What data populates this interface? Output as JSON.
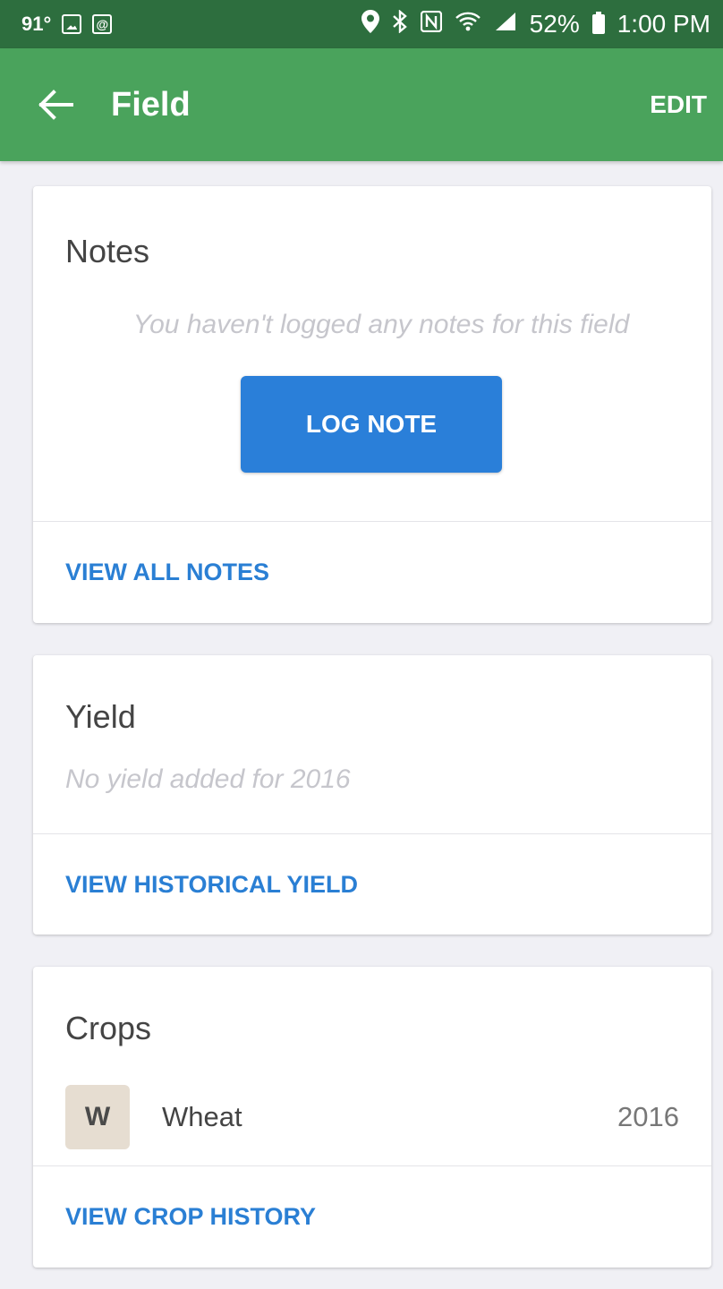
{
  "status_bar": {
    "temperature": "91°",
    "battery_percent": "52%",
    "time": "1:00 PM",
    "icons": [
      "image-icon",
      "email-at-icon",
      "location-icon",
      "bluetooth-icon",
      "nfc-icon",
      "wifi-icon",
      "signal-icon",
      "battery-icon"
    ]
  },
  "app_bar": {
    "title": "Field",
    "edit_label": "EDIT",
    "back_icon": "arrow-left-icon",
    "color": "#4aa35c"
  },
  "notes": {
    "title": "Notes",
    "empty_text": "You haven't logged any notes for this field",
    "button_label": "LOG NOTE",
    "action_label": "VIEW ALL NOTES"
  },
  "yield": {
    "title": "Yield",
    "empty_text": "No yield added for 2016",
    "action_label": "VIEW HISTORICAL YIELD"
  },
  "crops": {
    "title": "Crops",
    "items": [
      {
        "badge": "W",
        "name": "Wheat",
        "year": "2016"
      }
    ],
    "action_label": "VIEW CROP HISTORY"
  },
  "colors": {
    "primary_blue": "#2a7fd9",
    "link_blue": "#2a7fd4",
    "status_bar_green": "#2d6e3e"
  }
}
